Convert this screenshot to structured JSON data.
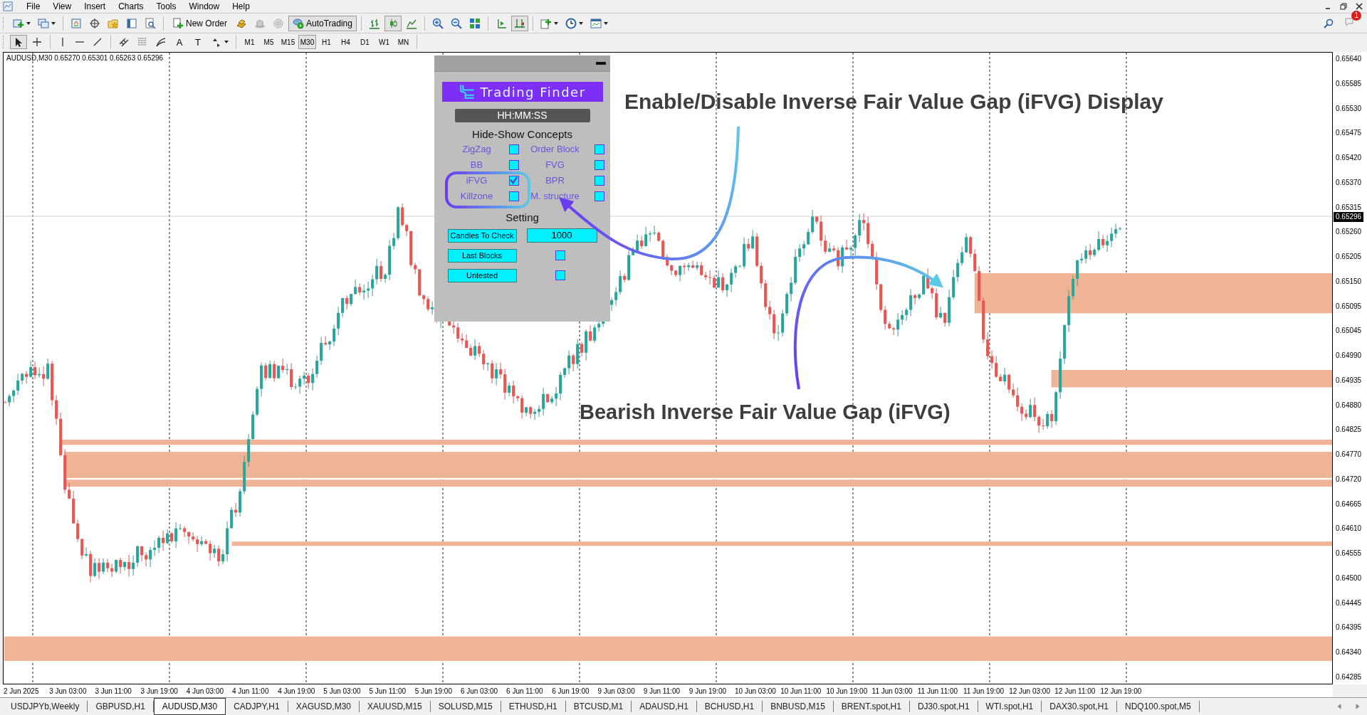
{
  "menu": [
    "File",
    "View",
    "Insert",
    "Charts",
    "Tools",
    "Window",
    "Help"
  ],
  "toolbar": {
    "new_order": "New Order",
    "auto_trading": {
      "label": "AutoTrading",
      "on": true
    },
    "chart_types": [
      {
        "kind": "bars",
        "selected": false
      },
      {
        "kind": "candles",
        "selected": true
      },
      {
        "kind": "line",
        "selected": false
      }
    ],
    "auto_scroll": false,
    "chart_shift": true,
    "notification_count": "1"
  },
  "drawing_tools": [
    {
      "kind": "cursor",
      "selected": true
    },
    {
      "kind": "crosshair",
      "selected": false
    },
    {
      "kind": "vline",
      "selected": false
    },
    {
      "kind": "hline",
      "selected": false
    },
    {
      "kind": "trendline",
      "selected": false
    },
    {
      "kind": "channel",
      "selected": false
    },
    {
      "kind": "fibo",
      "selected": false
    },
    {
      "kind": "fibofan",
      "selected": false
    },
    {
      "kind": "text",
      "label": "A",
      "selected": false
    },
    {
      "kind": "textlabel",
      "label": "T",
      "selected": false
    },
    {
      "kind": "arrows",
      "selected": false
    }
  ],
  "periods": [
    {
      "label": "M1",
      "selected": false
    },
    {
      "label": "M5",
      "selected": false
    },
    {
      "label": "M15",
      "selected": false
    },
    {
      "label": "M30",
      "selected": true
    },
    {
      "label": "H1",
      "selected": false
    },
    {
      "label": "H4",
      "selected": false
    },
    {
      "label": "D1",
      "selected": false
    },
    {
      "label": "W1",
      "selected": false
    },
    {
      "label": "MN",
      "selected": false
    }
  ],
  "chart": {
    "header": "AUDUSD,M30  0.65270 0.65301 0.65263 0.65296",
    "current_price": "0.65296",
    "price_labels": [
      "0.65640",
      "0.65585",
      "0.65530",
      "0.65475",
      "0.65420",
      "0.65370",
      "0.65315",
      "0.65260",
      "0.65205",
      "0.65150",
      "0.65095",
      "0.65045",
      "0.64990",
      "0.64935",
      "0.64880",
      "0.64825",
      "0.64770",
      "0.64720",
      "0.64665",
      "0.64610",
      "0.64555",
      "0.64500",
      "0.64445",
      "0.64395",
      "0.64340",
      "0.64285"
    ],
    "time_labels": [
      "2 Jun 2025",
      "3 Jun 03:00",
      "3 Jun 11:00",
      "3 Jun 19:00",
      "4 Jun 03:00",
      "4 Jun 11:00",
      "4 Jun 19:00",
      "5 Jun 03:00",
      "5 Jun 11:00",
      "5 Jun 19:00",
      "6 Jun 03:00",
      "6 Jun 11:00",
      "6 Jun 19:00",
      "9 Jun 03:00",
      "9 Jun 11:00",
      "9 Jun 19:00",
      "10 Jun 03:00",
      "10 Jun 11:00",
      "10 Jun 19:00",
      "11 Jun 03:00",
      "11 Jun 11:00",
      "11 Jun 19:00",
      "12 Jun 03:00",
      "12 Jun 11:00",
      "12 Jun 19:00"
    ]
  },
  "panel": {
    "logo_text": "Trading Finder",
    "clock": "HH:MM:SS",
    "concepts_title": "Hide-Show Concepts",
    "concepts": [
      {
        "label": "ZigZag",
        "checked": false
      },
      {
        "label": "Order Block",
        "checked": false
      },
      {
        "label": "BB",
        "checked": false
      },
      {
        "label": "FVG",
        "checked": false
      },
      {
        "label": "iFVG",
        "checked": true
      },
      {
        "label": "BPR",
        "checked": false
      },
      {
        "label": "Killzone",
        "checked": false
      },
      {
        "label": "M. structure",
        "checked": false
      }
    ],
    "setting_title": "Setting",
    "settings": [
      {
        "kind": "input",
        "label": "Candles To Check",
        "value": "1000"
      },
      {
        "kind": "checkbox",
        "label": "Last Blocks",
        "checked": false
      },
      {
        "kind": "checkbox",
        "label": "Untested",
        "checked": false
      }
    ]
  },
  "annotations": [
    {
      "text": "Enable/Disable Inverse Fair Value Gap (iFVG) Display"
    },
    {
      "text": "Bearish Inverse Fair Value Gap (iFVG)"
    }
  ],
  "tabs": [
    {
      "label": "USDJPYb,Weekly",
      "selected": false
    },
    {
      "label": "GBPUSD,H1",
      "selected": false
    },
    {
      "label": "AUDUSD,M30",
      "selected": true
    },
    {
      "label": "CADJPY,H1",
      "selected": false
    },
    {
      "label": "XAGUSD,M30",
      "selected": false
    },
    {
      "label": "XAUUSD,M15",
      "selected": false
    },
    {
      "label": "SOLUSD,M15",
      "selected": false
    },
    {
      "label": "ETHUSD,H1",
      "selected": false
    },
    {
      "label": "BTCUSD,M1",
      "selected": false
    },
    {
      "label": "ADAUSD,H1",
      "selected": false
    },
    {
      "label": "BCHUSD,H1",
      "selected": false
    },
    {
      "label": "BNBUSD,M15",
      "selected": false
    },
    {
      "label": "BRENT.spot,H1",
      "selected": false
    },
    {
      "label": "DJ30.spot,H1",
      "selected": false
    },
    {
      "label": "WTI.spot,H1",
      "selected": false
    },
    {
      "label": "DAX30.spot,H1",
      "selected": false
    },
    {
      "label": "NDQ100.spot,M5",
      "selected": false
    }
  ]
}
